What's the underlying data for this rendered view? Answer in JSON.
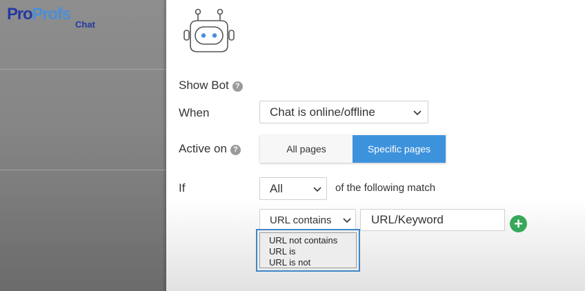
{
  "logo": {
    "text_part1": "Pro",
    "text_part2": "Profs",
    "sub": "Chat"
  },
  "icons": {
    "bot": "robot-icon",
    "help": "question-circle-icon",
    "chevron": "chevron-down-icon",
    "add": "plus-circle-icon"
  },
  "colors": {
    "primary_blue": "#3d92dc",
    "add_green": "#37a85a",
    "focus_blue": "#3f86c8",
    "sidebar_gray": "#858585"
  },
  "form": {
    "show_bot_label": "Show Bot",
    "when_label": "When",
    "when_value": "Chat is online/offline",
    "active_on_label": "Active on",
    "active_on_options": [
      "All pages",
      "Specific pages"
    ],
    "active_on_selected": "Specific pages",
    "if_label": "If",
    "match_value": "All",
    "match_suffix": "of the following match",
    "condition_value": "URL contains",
    "keyword_value": "URL/Keyword",
    "condition_options": [
      "URL not contains",
      "URL is",
      "URL is not"
    ]
  }
}
